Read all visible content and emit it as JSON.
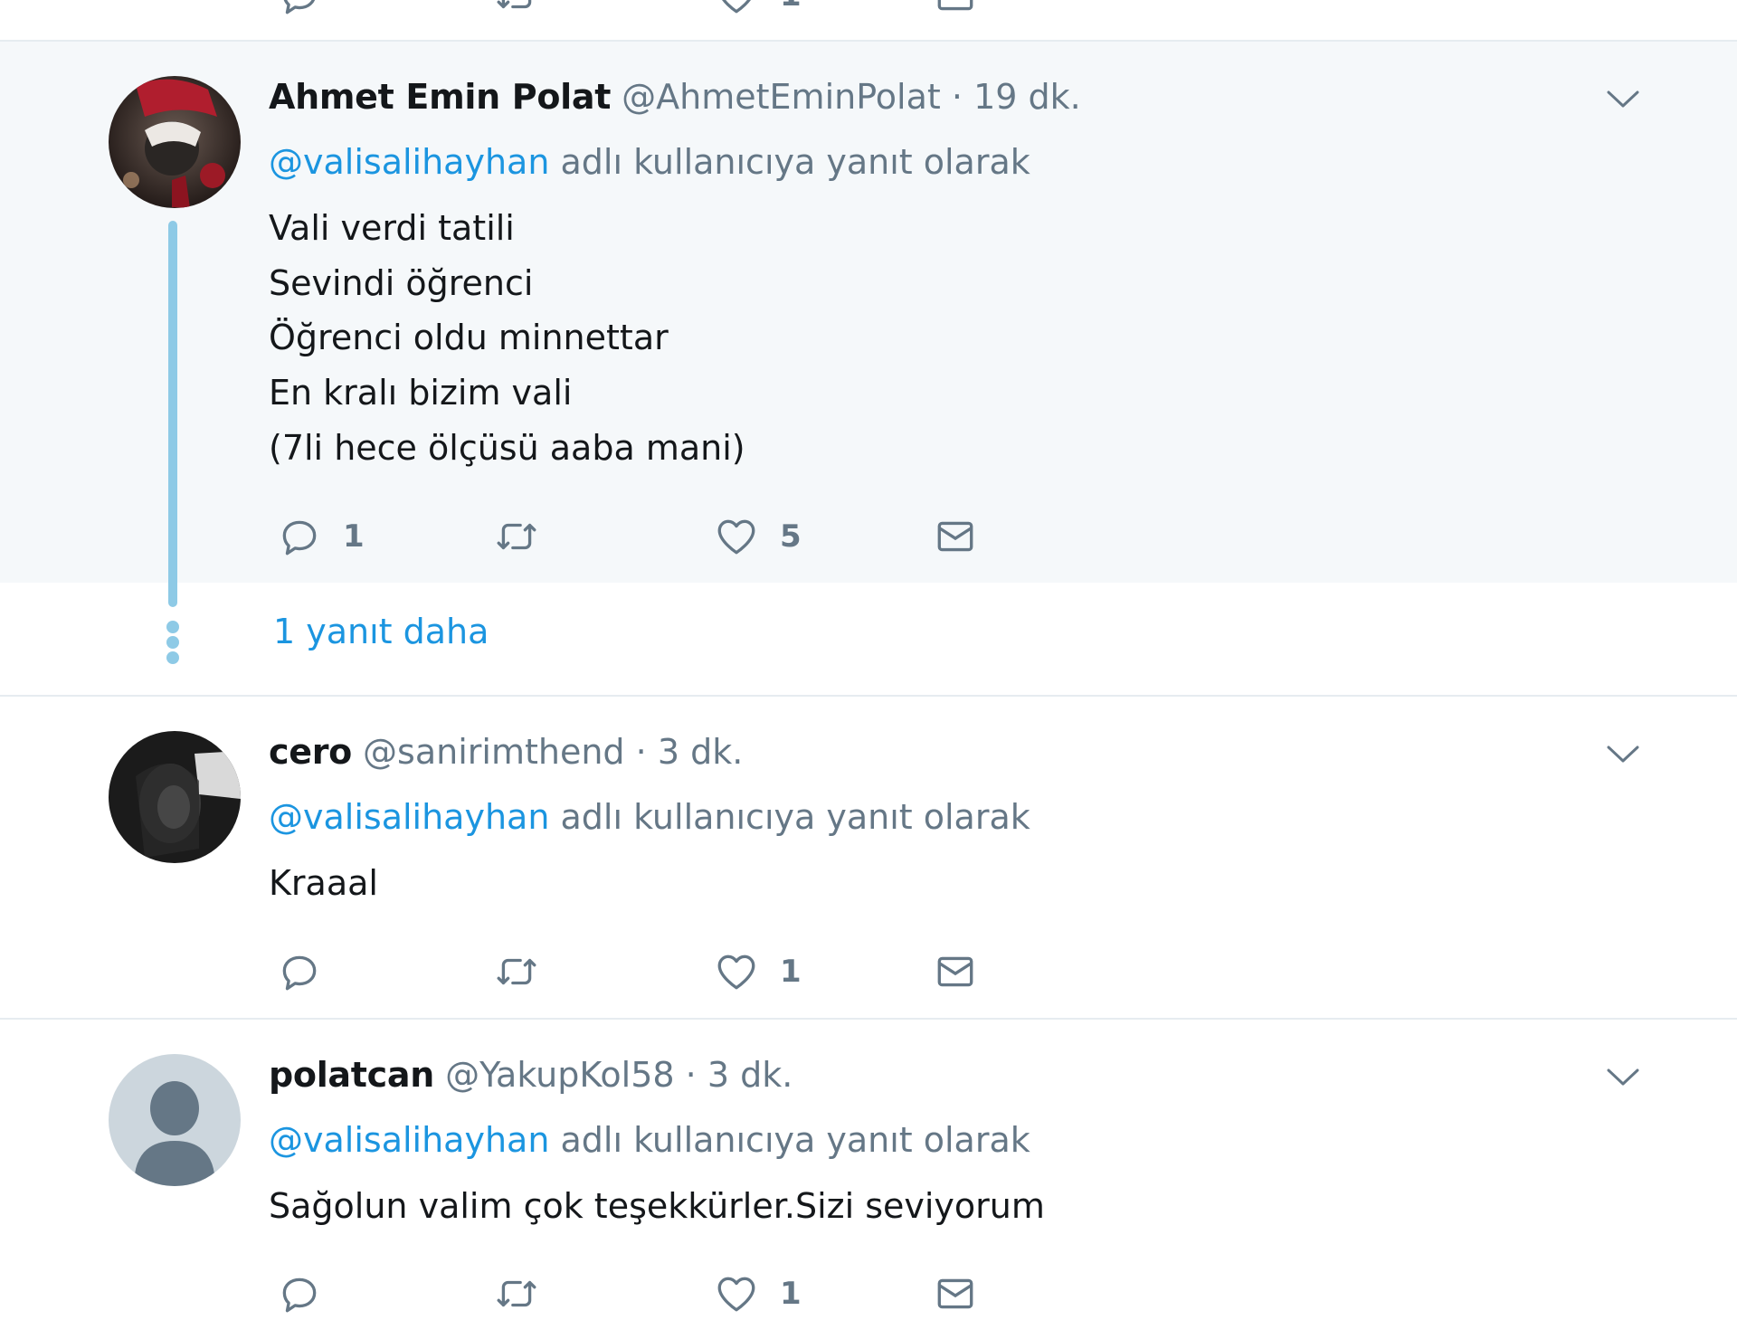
{
  "top_partial": {
    "like_count": "1"
  },
  "tweets": [
    {
      "name": "Ahmet Emin Polat",
      "handle": "@AhmetEminPolat",
      "sep": "·",
      "time": "19 dk.",
      "reply_mention": "@valisalihayhan",
      "reply_suffix": " adlı kullanıcıya yanıt olarak",
      "lines": [
        "Vali verdi tatili",
        "Sevindi öğrenci",
        "Öğrenci oldu minnettar",
        "En kralı bizim vali",
        "(7li hece ölçüsü aaba mani)"
      ],
      "reply_count": "1",
      "like_count": "5",
      "more_replies": "1 yanıt daha"
    },
    {
      "name": "cero",
      "handle": "@sanirimthend",
      "sep": "·",
      "time": "3 dk.",
      "reply_mention": "@valisalihayhan",
      "reply_suffix": " adlı kullanıcıya yanıt olarak",
      "lines": [
        "Kraaal"
      ],
      "reply_count": "",
      "like_count": "1"
    },
    {
      "name": "polatcan",
      "handle": "@YakupKol58",
      "sep": "·",
      "time": "3 dk.",
      "reply_mention": "@valisalihayhan",
      "reply_suffix": " adlı kullanıcıya yanıt olarak",
      "lines": [
        "Sağolun valim çok teşekkürler.Sizi seviyorum"
      ],
      "reply_count": "",
      "like_count": "1"
    }
  ],
  "icons": {
    "reply": "reply-icon",
    "retweet": "retweet-icon",
    "like": "heart-icon",
    "dm": "envelope-icon",
    "caret": "chevron-down-icon"
  },
  "colors": {
    "link": "#1b95e0",
    "secondary_text": "#657786",
    "thread_line": "#8ecae6",
    "highlight_bg": "#f5f8fa"
  }
}
